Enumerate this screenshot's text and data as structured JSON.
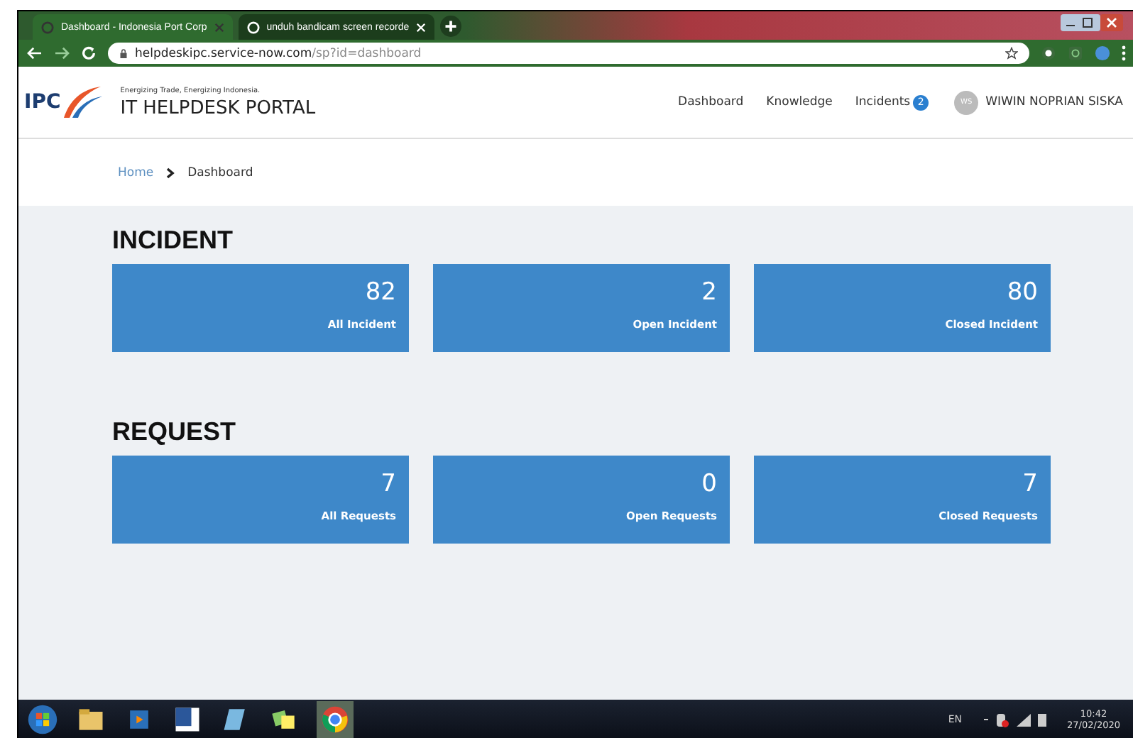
{
  "browser": {
    "tabs": [
      {
        "title": "Dashboard - Indonesia Port Corp",
        "selected": true
      },
      {
        "title": "unduh bandicam screen recorde",
        "selected": false
      }
    ],
    "url_host": "helpdeskipc.service-now.com",
    "url_path": "/sp?id=dashboard"
  },
  "portal": {
    "logo": "IPC",
    "tagline": "Energizing Trade, Energizing Indonesia.",
    "title": "IT HELPDESK PORTAL",
    "nav": [
      {
        "label": "Dashboard"
      },
      {
        "label": "Knowledge"
      },
      {
        "label": "Incidents",
        "badge": "2"
      }
    ],
    "user": {
      "initials": "WS",
      "name": "WIWIN NOPRIAN SISKA"
    }
  },
  "breadcrumb": [
    "Home",
    "Dashboard"
  ],
  "sections": [
    {
      "title": "INCIDENT",
      "cards": [
        {
          "value": "82",
          "label": "All Incident"
        },
        {
          "value": "2",
          "label": "Open Incident"
        },
        {
          "value": "80",
          "label": "Closed Incident"
        }
      ]
    },
    {
      "title": "REQUEST",
      "cards": [
        {
          "value": "7",
          "label": "All Requests"
        },
        {
          "value": "0",
          "label": "Open Requests"
        },
        {
          "value": "7",
          "label": "Closed Requests"
        }
      ]
    }
  ],
  "taskbar": {
    "language": "EN",
    "time": "10:42",
    "date": "27/02/2020"
  }
}
